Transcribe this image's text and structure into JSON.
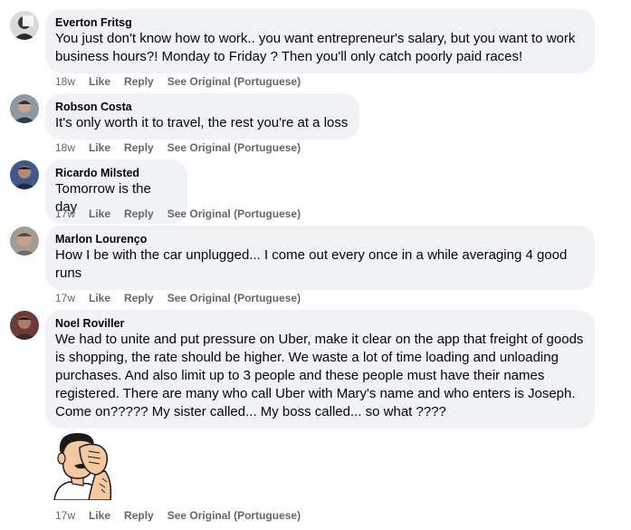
{
  "comments": [
    {
      "author": "Everton Fritsg",
      "text": "You just don't know how to work.. you want entrepreneur's salary, but you want to work business hours?! Monday to Friday ? Then you'll only catch poorly paid races!",
      "time": "18w",
      "like": "Like",
      "reply": "Reply",
      "see_original": "See Original (Portuguese)"
    },
    {
      "author": "Robson Costa",
      "text": "It's only worth it to travel, the rest you're at a loss",
      "time": "18w",
      "like": "Like",
      "reply": "Reply",
      "see_original": "See Original (Portuguese)"
    },
    {
      "author": "Ricardo Milsted",
      "text": "Tomorrow is the day",
      "time": "17w",
      "like": "Like",
      "reply": "Reply",
      "see_original": "See Original (Portuguese)"
    },
    {
      "author": "Marlon Lourenço",
      "text": "How I be with the car unplugged... I come out every once in a while averaging 4 good runs",
      "time": "17w",
      "like": "Like",
      "reply": "Reply",
      "see_original": "See Original (Portuguese)"
    },
    {
      "author": "Noel Roviller",
      "text": "We had to unite and put pressure on Uber, make it clear on the app that freight of goods is shopping, the rate should be higher. We waste a lot of time loading and unloading purchases. And also limit up to 3 people and these people must have their names registered. There are many who call Uber with Mary's name and who enters is Joseph. Come on????? My sister called... My boss called... so what ????",
      "time": "17w",
      "like": "Like",
      "reply": "Reply",
      "see_original": "See Original (Portuguese)",
      "sticker": "facepalm-sticker"
    }
  ],
  "colors": {
    "bubble": "#f0f2f5",
    "meta": "#65676b",
    "text": "#050505"
  }
}
